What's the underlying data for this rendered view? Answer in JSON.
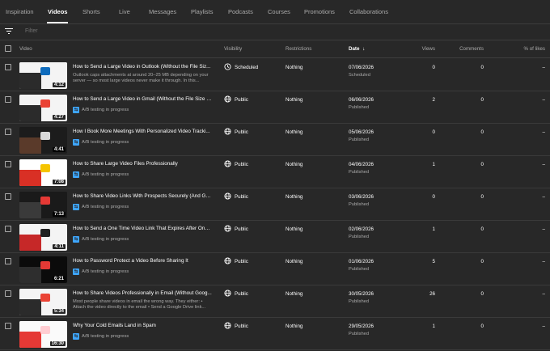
{
  "tabs": [
    {
      "label": "Inspiration",
      "active": false
    },
    {
      "label": "Videos",
      "active": true
    },
    {
      "label": "Shorts",
      "active": false
    },
    {
      "label": "Live",
      "active": false
    },
    {
      "label": "Messages",
      "active": false
    },
    {
      "label": "Playlists",
      "active": false
    },
    {
      "label": "Podcasts",
      "active": false
    },
    {
      "label": "Courses",
      "active": false
    },
    {
      "label": "Promotions",
      "active": false
    },
    {
      "label": "Collaborations",
      "active": false
    }
  ],
  "filter": {
    "placeholder": "Filter"
  },
  "columns": {
    "video": "Video",
    "visibility": "Visibility",
    "restrictions": "Restrictions",
    "date": "Date",
    "views": "Views",
    "comments": "Comments",
    "likes": "% of likes"
  },
  "rows": [
    {
      "title": "How to Send a Large Video in Outlook (Without the File Siz...",
      "description": "Outlook caps attachments at around 20–25 MB depending on your server — so most large videos never make it through. In this...",
      "ab_testing": "",
      "duration": "4:12",
      "visibility": "Scheduled",
      "restrictions": "Nothing",
      "date": "07/06/2026",
      "status": "Scheduled",
      "views": "0",
      "comments": "0",
      "likes": "–"
    },
    {
      "title": "How to Send a Large Video in Gmail (Without the File Size L...",
      "description": "",
      "ab_testing": "A/B testing in progress",
      "duration": "4:27",
      "visibility": "Public",
      "restrictions": "Nothing",
      "date": "06/06/2026",
      "status": "Published",
      "views": "2",
      "comments": "0",
      "likes": "–"
    },
    {
      "title": "How I Book More Meetings With Personalized Video Tracki...",
      "description": "",
      "ab_testing": "A/B testing in progress",
      "duration": "4:41",
      "visibility": "Public",
      "restrictions": "Nothing",
      "date": "05/06/2026",
      "status": "Published",
      "views": "0",
      "comments": "0",
      "likes": "–"
    },
    {
      "title": "How to Share Large Video Files Professionally",
      "description": "",
      "ab_testing": "A/B testing in progress",
      "duration": "7:08",
      "visibility": "Public",
      "restrictions": "Nothing",
      "date": "04/06/2026",
      "status": "Published",
      "views": "1",
      "comments": "0",
      "likes": "–"
    },
    {
      "title": "How to Share Video Links With Prospects Securely (And Ge...",
      "description": "",
      "ab_testing": "A/B testing in progress",
      "duration": "7:13",
      "visibility": "Public",
      "restrictions": "Nothing",
      "date": "03/06/2026",
      "status": "Published",
      "views": "0",
      "comments": "0",
      "likes": "–"
    },
    {
      "title": "How to Send a One Time Video Link That Expires After One ...",
      "description": "",
      "ab_testing": "A/B testing in progress",
      "duration": "4:11",
      "visibility": "Public",
      "restrictions": "Nothing",
      "date": "02/06/2026",
      "status": "Published",
      "views": "1",
      "comments": "0",
      "likes": "–"
    },
    {
      "title": "How to Password Protect a Video Before Sharing It",
      "description": "",
      "ab_testing": "A/B testing in progress",
      "duration": "6:21",
      "visibility": "Public",
      "restrictions": "Nothing",
      "date": "01/06/2026",
      "status": "Published",
      "views": "5",
      "comments": "0",
      "likes": "–"
    },
    {
      "title": "How to Share Videos Professionally in Email (Without Goog...",
      "description": "Most people share videos in email the wrong way. They either: • Attach the video directly to the email • Send a Google Drive link...",
      "ab_testing": "",
      "duration": "5:34",
      "visibility": "Public",
      "restrictions": "Nothing",
      "date": "30/05/2026",
      "status": "Published",
      "views": "26",
      "comments": "0",
      "likes": "–"
    },
    {
      "title": "Why Your Cold Emails Land in Spam",
      "description": "",
      "ab_testing": "A/B testing in progress",
      "duration": "16:30",
      "visibility": "Public",
      "restrictions": "Nothing",
      "date": "29/05/2026",
      "status": "Published",
      "views": "1",
      "comments": "0",
      "likes": "–"
    }
  ],
  "colors": {
    "background": "#282828",
    "text": "#ffffff",
    "muted": "#aaaaaa",
    "ab_accent": "#3ea6ff"
  }
}
